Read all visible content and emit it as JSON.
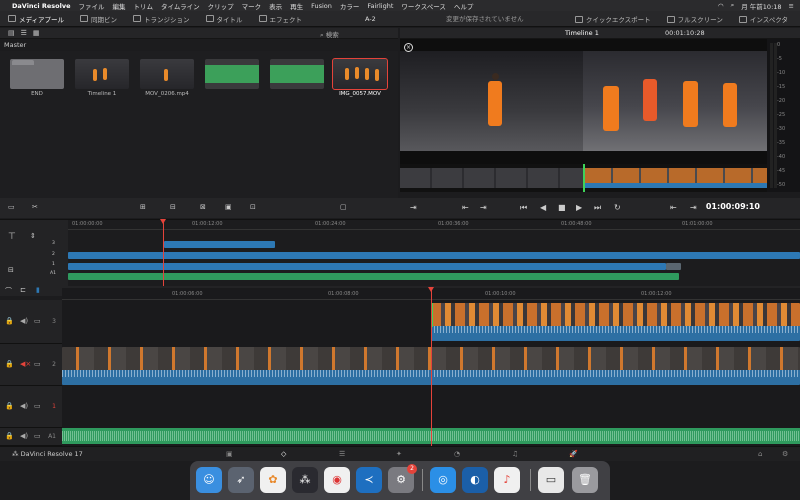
{
  "menubar": {
    "apple": "",
    "app": "DaVinci Resolve",
    "items": [
      "ファイル",
      "編集",
      "トリム",
      "タイムライン",
      "クリップ",
      "マーク",
      "表示",
      "再生",
      "Fusion",
      "カラー",
      "Fairlight",
      "ワークスペース",
      "ヘルプ"
    ],
    "clock": "月 午前10:18"
  },
  "toolbar": {
    "tabs": [
      "メディアプール",
      "同期ビン",
      "トランジション",
      "タイトル",
      "エフェクト"
    ],
    "project": "A-2",
    "status": "変更が保存されていません",
    "right": [
      "クイックエクスポート",
      "フルスクリーン",
      "インスペクタ"
    ]
  },
  "media_pool": {
    "search_placeholder": "検索",
    "bin": "Master",
    "clips": [
      {
        "label": "END",
        "kind": "folder",
        "selected": false
      },
      {
        "label": "Timeline 1",
        "kind": "stage",
        "selected": false
      },
      {
        "label": "MOV_0206.mp4",
        "kind": "stage",
        "selected": false
      },
      {
        "label": "",
        "kind": "green",
        "selected": false
      },
      {
        "label": "",
        "kind": "green",
        "selected": false
      },
      {
        "label": "IMG_0057.MOV",
        "kind": "stage",
        "selected": true
      }
    ]
  },
  "viewer": {
    "timeline_name": "Timeline 1",
    "timecode_top": "00:01:10:28",
    "timecode": "01:00:09:10",
    "meter_labels": [
      "0",
      "-5",
      "-10",
      "-15",
      "-20",
      "-25",
      "-30",
      "-35",
      "-40",
      "-45",
      "-50"
    ]
  },
  "upper_timeline": {
    "ticks": [
      "01:00:00:00",
      "01:00:12:00",
      "01:00:24:00",
      "01:00:36:00",
      "01:00:48:00",
      "01:01:00:00"
    ],
    "track_labels": [
      "3",
      "2",
      "1",
      "A1"
    ]
  },
  "lower_timeline": {
    "ticks": [
      "01:00:06:00",
      "01:00:08:00",
      "01:00:10:00",
      "01:00:12:00"
    ],
    "tracks": [
      "3",
      "2",
      "1",
      "A1"
    ]
  },
  "status": {
    "brand": "DaVinci Resolve 17"
  },
  "dock": {
    "items": [
      "finder",
      "launchpad",
      "photos",
      "davinci-resolve",
      "chrome",
      "vscode",
      "system-preferences",
      "safari",
      "edge",
      "music",
      "window-preview",
      "trash"
    ],
    "badge": "2"
  }
}
